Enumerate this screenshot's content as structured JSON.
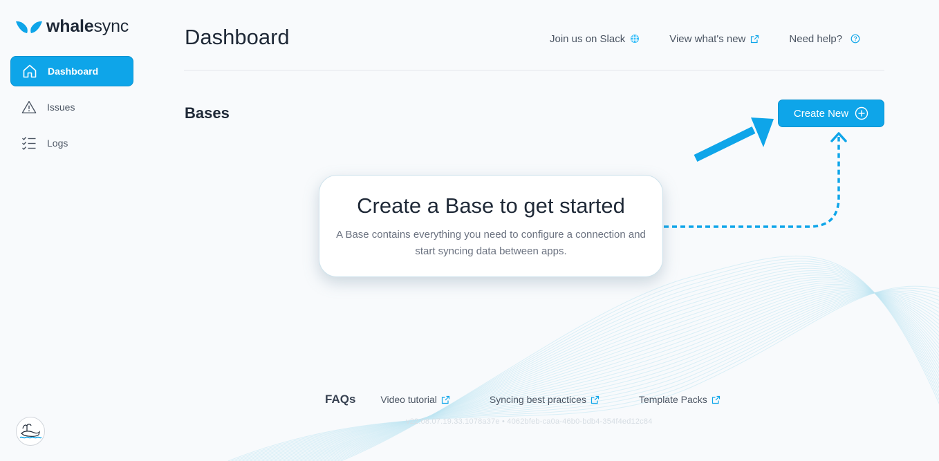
{
  "brand": {
    "name_bold": "whale",
    "name_light": "sync",
    "accent": "#0ea5e9"
  },
  "sidebar": {
    "items": [
      {
        "label": "Dashboard",
        "icon": "home-icon",
        "active": true
      },
      {
        "label": "Issues",
        "icon": "warning-triangle-icon",
        "active": false
      },
      {
        "label": "Logs",
        "icon": "checklist-icon",
        "active": false
      }
    ]
  },
  "header": {
    "title": "Dashboard",
    "links": [
      {
        "label": "Join us on Slack",
        "icon": "slack-icon"
      },
      {
        "label": "View what's new",
        "icon": "external-link-icon"
      },
      {
        "label": "Need help?",
        "icon": "help-circle-icon"
      }
    ]
  },
  "bases": {
    "title": "Bases",
    "create_label": "Create New"
  },
  "empty_state": {
    "title": "Create a Base to get started",
    "description": "A Base contains everything you need to configure a connection and start syncing data between apps."
  },
  "footer": {
    "faq_title": "FAQs",
    "links": [
      {
        "label": "Video tutorial",
        "icon": "external-link-icon"
      },
      {
        "label": "Syncing best practices",
        "icon": "external-link-icon"
      },
      {
        "label": "Template Packs",
        "icon": "external-link-icon"
      }
    ],
    "version": "v22.08.07.19.33.1078a37e • 4062bfeb-ca0a-46b0-bdb4-354f4ed12c84"
  },
  "colors": {
    "primary": "#0ea5e9",
    "background": "#f8fafc",
    "wave": "#bfe6f3"
  }
}
